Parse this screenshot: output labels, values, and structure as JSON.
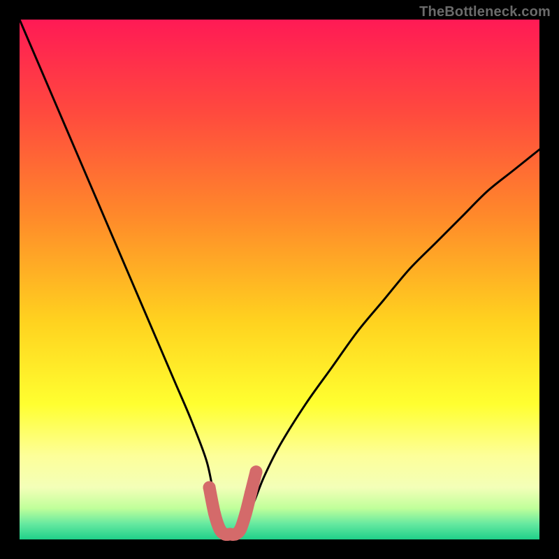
{
  "watermark": {
    "text": "TheBottleneck.com"
  },
  "colors": {
    "frame": "#000000",
    "curve": "#000000",
    "marker": "#d46a6a",
    "gradient_stops": [
      {
        "pct": 0,
        "color": "#ff1a55"
      },
      {
        "pct": 18,
        "color": "#ff4a3e"
      },
      {
        "pct": 38,
        "color": "#ff8a2a"
      },
      {
        "pct": 58,
        "color": "#ffd21f"
      },
      {
        "pct": 74,
        "color": "#ffff30"
      },
      {
        "pct": 84,
        "color": "#fdff9a"
      },
      {
        "pct": 90,
        "color": "#f3ffb8"
      },
      {
        "pct": 94,
        "color": "#c0ff9a"
      },
      {
        "pct": 97,
        "color": "#66e9a0"
      },
      {
        "pct": 100,
        "color": "#1fd089"
      }
    ]
  },
  "chart_data": {
    "type": "line",
    "title": "",
    "xlabel": "",
    "ylabel": "",
    "xlim": [
      0,
      100
    ],
    "ylim": [
      0,
      100
    ],
    "series": [
      {
        "name": "bottleneck-curve",
        "x": [
          0,
          3,
          6,
          9,
          12,
          15,
          18,
          21,
          24,
          27,
          30,
          33,
          36,
          37.5,
          39,
          40,
          41.5,
          43,
          45,
          47,
          50,
          55,
          60,
          65,
          70,
          75,
          80,
          85,
          90,
          95,
          100
        ],
        "values": [
          100,
          93,
          86,
          79,
          72,
          65,
          58,
          51,
          44,
          37,
          30,
          23,
          15,
          8,
          3,
          1,
          1,
          3,
          7,
          12,
          18,
          26,
          33,
          40,
          46,
          52,
          57,
          62,
          67,
          71,
          75
        ]
      }
    ],
    "markers": {
      "name": "optimal-range",
      "x": [
        36.5,
        37.5,
        38.5,
        39.5,
        40.5,
        41.5,
        42.5,
        43.5,
        44.5,
        45.5
      ],
      "values": [
        10,
        5,
        2,
        1,
        1,
        1,
        2,
        5,
        9,
        13
      ]
    }
  }
}
